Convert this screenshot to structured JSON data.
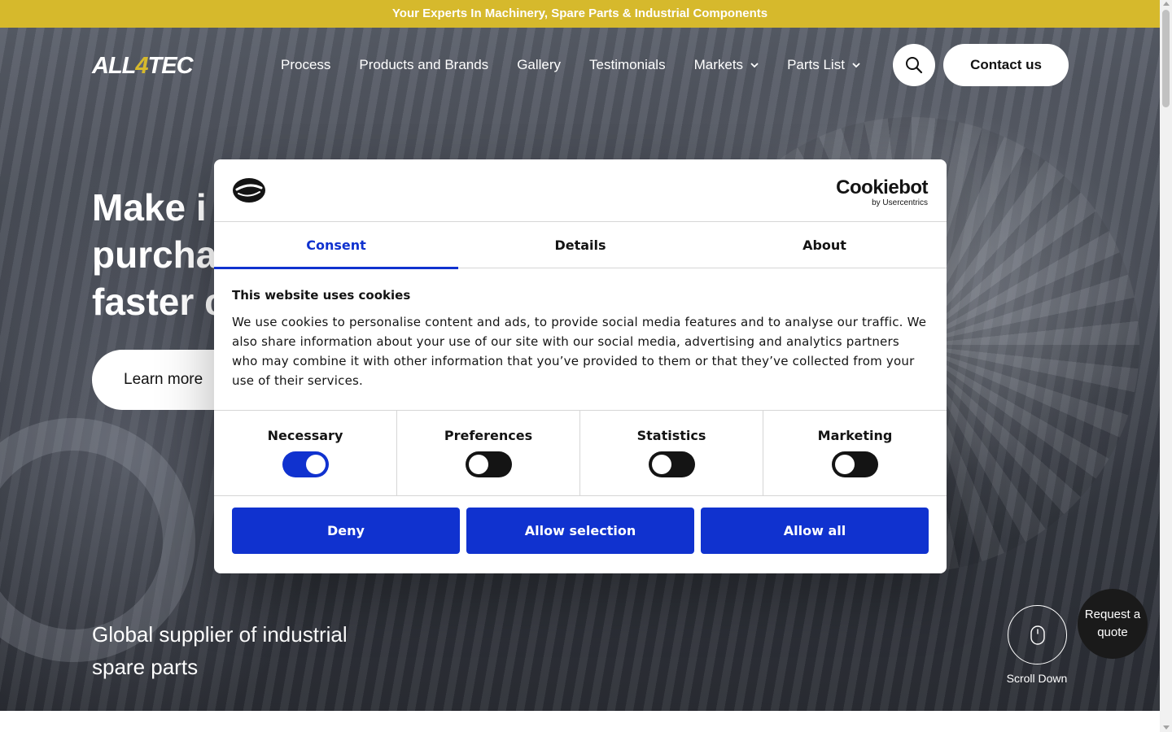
{
  "announcement": "Your Experts In Machinery, Spare Parts & Industrial Components",
  "brand": {
    "logo_left": "ALL",
    "logo_accent": "4",
    "logo_right": "TEC"
  },
  "nav": {
    "items": [
      {
        "label": "Process"
      },
      {
        "label": "Products and Brands"
      },
      {
        "label": "Gallery"
      },
      {
        "label": "Testimonials"
      },
      {
        "label": "Markets"
      },
      {
        "label": "Parts List"
      }
    ],
    "contact_label": "Contact us"
  },
  "hero": {
    "headline_lines": [
      "Make i",
      "purcha",
      "faster c"
    ],
    "cta_label": "Learn more",
    "subline": "Global supplier of industrial spare parts",
    "scroll_label": "Scroll Down",
    "quote_label": "Request a quote"
  },
  "cookie_dialog": {
    "brand_name": "Cookiebot",
    "brand_by": "by Usercentrics",
    "tabs": [
      {
        "label": "Consent"
      },
      {
        "label": "Details"
      },
      {
        "label": "About"
      }
    ],
    "title": "This website uses cookies",
    "text": "We use cookies to personalise content and ads, to provide social media features and to analyse our traffic. We also share information about your use of our site with our social media, advertising and analytics partners who may combine it with other information that you’ve provided to them or that they’ve collected from your use of their services.",
    "toggles": [
      {
        "label": "Necessary"
      },
      {
        "label": "Preferences"
      },
      {
        "label": "Statistics"
      },
      {
        "label": "Marketing"
      }
    ],
    "buttons": {
      "deny": "Deny",
      "allow_selection": "Allow selection",
      "allow_all": "Allow all"
    }
  },
  "colors": {
    "announcement_bg": "#d6b92c",
    "cookie_accent": "#1032cf"
  }
}
